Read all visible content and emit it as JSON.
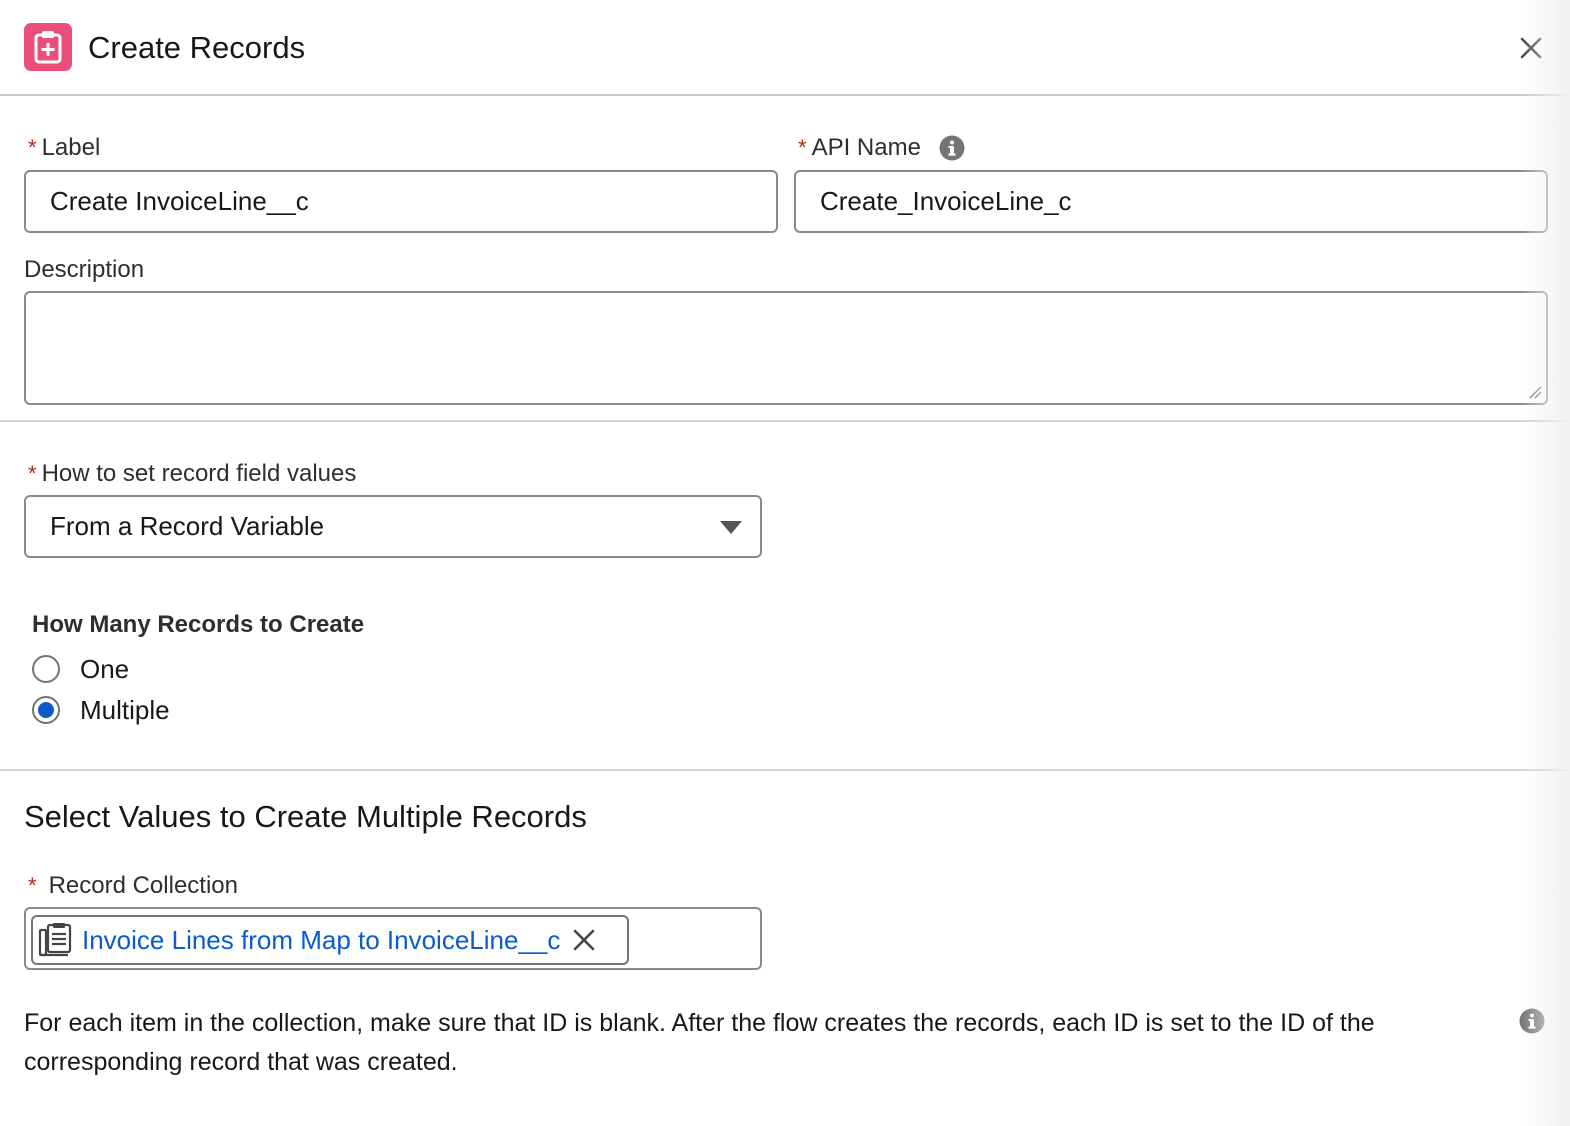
{
  "header": {
    "title": "Create Records",
    "icon": "clipboard-plus-icon",
    "icon_color": "#ea4f7a",
    "close_icon": "close-icon"
  },
  "fields": {
    "label": {
      "label": "Label",
      "required_mark": "*",
      "value": "Create InvoiceLine__c"
    },
    "api_name": {
      "label": "API Name",
      "required_mark": "*",
      "value": "Create_InvoiceLine_c"
    },
    "description": {
      "label": "Description",
      "value": ""
    }
  },
  "field_values": {
    "label": "How to set record field values",
    "required_mark": "*",
    "selected": "From a Record Variable"
  },
  "record_count": {
    "title": "How Many Records to Create",
    "options": [
      {
        "label": "One",
        "selected": false
      },
      {
        "label": "Multiple",
        "selected": true
      }
    ]
  },
  "multiple": {
    "section_title": "Select Values to Create Multiple Records",
    "collection_label": "Record Collection",
    "required_mark": "*",
    "collection_value": "Invoice Lines from Map to InvoiceLine__c",
    "help_text": "For each item in the collection, make sure that ID is blank. After the flow creates the records, each ID is set to the ID of the corresponding record that was created."
  },
  "colors": {
    "accent": "#0b5cc9",
    "required": "#b0281a"
  }
}
